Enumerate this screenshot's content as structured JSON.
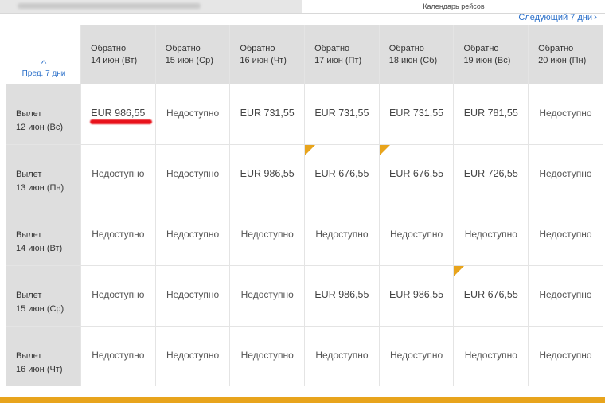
{
  "header": {
    "title": "Календарь рейсов",
    "next_link": "Следующий 7 дни",
    "prev_link": "Пред. 7 дни"
  },
  "columns": [
    {
      "label": "Обратно",
      "date": "14 июн (Вт)"
    },
    {
      "label": "Обратно",
      "date": "15 июн (Ср)"
    },
    {
      "label": "Обратно",
      "date": "16 июн (Чт)"
    },
    {
      "label": "Обратно",
      "date": "17 июн (Пт)"
    },
    {
      "label": "Обратно",
      "date": "18 июн (Сб)"
    },
    {
      "label": "Обратно",
      "date": "19 июн (Вс)"
    },
    {
      "label": "Обратно",
      "date": "20 июн (Пн)"
    }
  ],
  "rows": [
    {
      "label": "Вылет",
      "date": "12 июн (Вс)",
      "cells": [
        "EUR 986,55",
        "Недоступно",
        "EUR 731,55",
        "EUR 731,55",
        "EUR 731,55",
        "EUR 781,55",
        "Недоступно"
      ]
    },
    {
      "label": "Вылет",
      "date": "13 июн (Пн)",
      "cells": [
        "Недоступно",
        "Недоступно",
        "EUR 986,55",
        "EUR 676,55",
        "EUR 676,55",
        "EUR 726,55",
        "Недоступно"
      ]
    },
    {
      "label": "Вылет",
      "date": "14 июн (Вт)",
      "cells": [
        "Недоступно",
        "Недоступно",
        "Недоступно",
        "Недоступно",
        "Недоступно",
        "Недоступно",
        "Недоступно"
      ]
    },
    {
      "label": "Вылет",
      "date": "15 июн (Ср)",
      "cells": [
        "Недоступно",
        "Недоступно",
        "Недоступно",
        "EUR 986,55",
        "EUR 986,55",
        "EUR 676,55",
        "Недоступно"
      ]
    },
    {
      "label": "Вылет",
      "date": "16 июн (Чт)",
      "cells": [
        "Недоступно",
        "Недоступно",
        "Недоступно",
        "Недоступно",
        "Недоступно",
        "Недоступно",
        "Недоступно"
      ]
    }
  ],
  "icons": {
    "next": "chevron-right-icon",
    "prev": "chevron-up-icon",
    "lowest_fare_marker": "corner-flag-icon"
  },
  "colors": {
    "accent_link": "#2a6fc9",
    "lowest_fare_marker": "#e8a41c",
    "header_cell": "#dedede",
    "bottom_bar": "#e8a41c",
    "annotation": "#e8111a"
  }
}
